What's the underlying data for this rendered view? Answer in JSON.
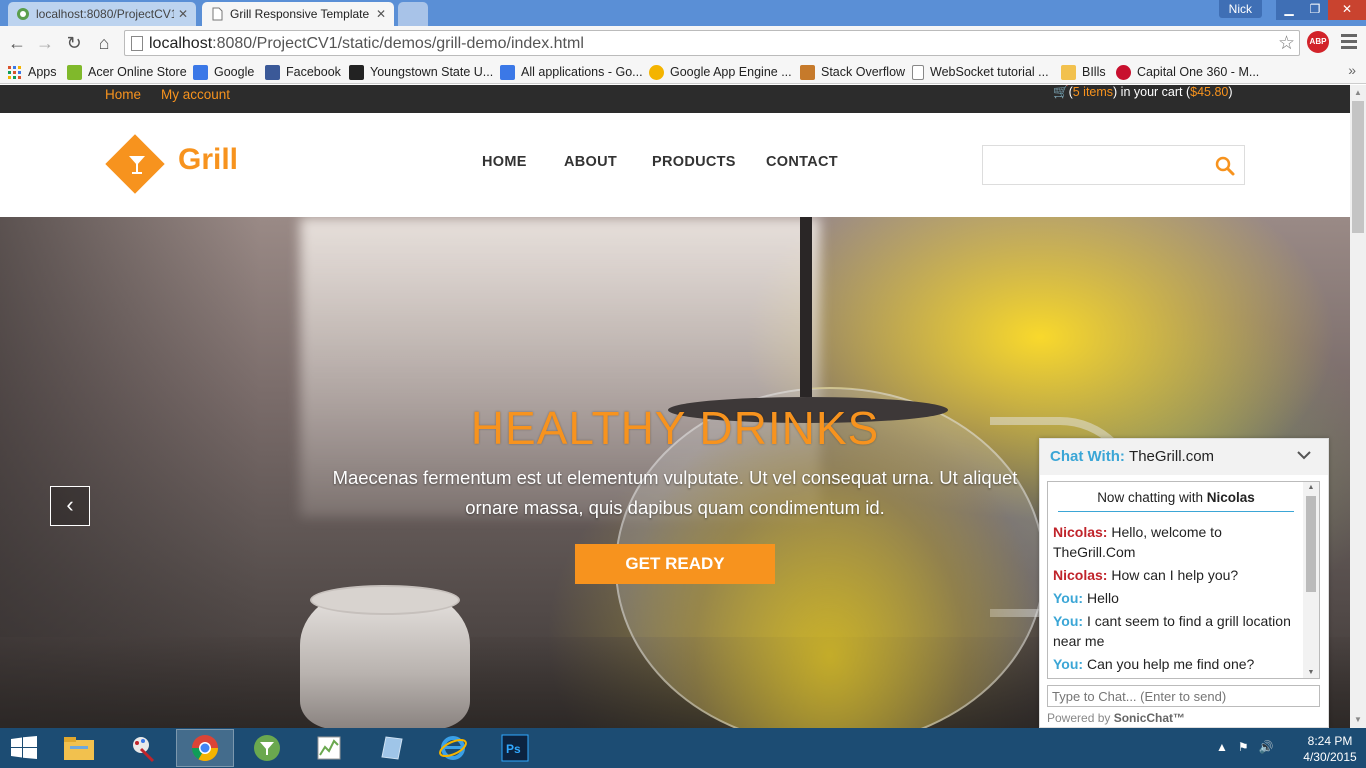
{
  "browser": {
    "tabs": [
      {
        "label": "localhost:8080/ProjectCV1",
        "active": false
      },
      {
        "label": "Grill Responsive Template",
        "active": true
      }
    ],
    "user_name": "Nick",
    "url_host": "localhost",
    "url_rest": ":8080/ProjectCV1/static/demos/grill-demo/index.html",
    "abp_label": "ABP"
  },
  "bookmarks": [
    {
      "label": "Apps",
      "icon": "apps-grid-icon",
      "color": "#d9532c"
    },
    {
      "label": "Acer Online Store",
      "icon": "acer-icon",
      "color": "#80b92b"
    },
    {
      "label": "Google",
      "icon": "google-icon",
      "color": "#3b78e7"
    },
    {
      "label": "Facebook",
      "icon": "facebook-icon",
      "color": "#3b5998"
    },
    {
      "label": "Youngstown State U...",
      "icon": "ysu-icon",
      "color": "#222222"
    },
    {
      "label": "All applications - Go...",
      "icon": "google-icon",
      "color": "#3b78e7"
    },
    {
      "label": "Google App Engine ...",
      "icon": "app-engine-icon",
      "color": "#f4b400"
    },
    {
      "label": "Stack Overflow",
      "icon": "stack-overflow-icon",
      "color": "#c67a2b"
    },
    {
      "label": "WebSocket tutorial ...",
      "icon": "page-icon",
      "color": "#ffffff"
    },
    {
      "label": "BIlls",
      "icon": "folder-icon",
      "color": "#f2c14e"
    },
    {
      "label": "Capital One 360 - M...",
      "icon": "capital-one-icon",
      "color": "#c8102e"
    }
  ],
  "site": {
    "topbar": {
      "home": "Home",
      "account": "My account",
      "cart_count": "5 items",
      "cart_mid": ") in your cart (",
      "cart_total": "$45.80"
    },
    "logo_text": "Grill",
    "nav": [
      "HOME",
      "ABOUT",
      "PRODUCTS",
      "CONTACT"
    ],
    "search_placeholder": "",
    "hero": {
      "title": "HEALTHY DRINKS",
      "text": "Maecenas fermentum est ut elementum vulputate. Ut vel consequat urna. Ut aliquet ornare massa, quis dapibus quam condimentum id.",
      "cta": "GET READY"
    },
    "accent": "#f7931e"
  },
  "chat": {
    "label": "Chat With:",
    "site": "TheGrill.com",
    "banner_prefix": "Now chatting with",
    "agent_name": "Nicolas",
    "messages": [
      {
        "who": "Nicolas:",
        "role": "agent",
        "text": "Hello, welcome to TheGrill.Com"
      },
      {
        "who": "Nicolas:",
        "role": "agent",
        "text": "How can I help you?"
      },
      {
        "who": "You:",
        "role": "user",
        "text": "Hello"
      },
      {
        "who": "You:",
        "role": "user",
        "text": "I cant seem to find a grill location near me"
      },
      {
        "who": "You:",
        "role": "user",
        "text": "Can you help me find one?"
      }
    ],
    "input_placeholder": "Type to Chat... (Enter to send)",
    "powered_prefix": "Powered by",
    "powered_brand": "SonicChat™"
  },
  "taskbar": {
    "time": "8:24 PM",
    "date": "4/30/2015"
  }
}
